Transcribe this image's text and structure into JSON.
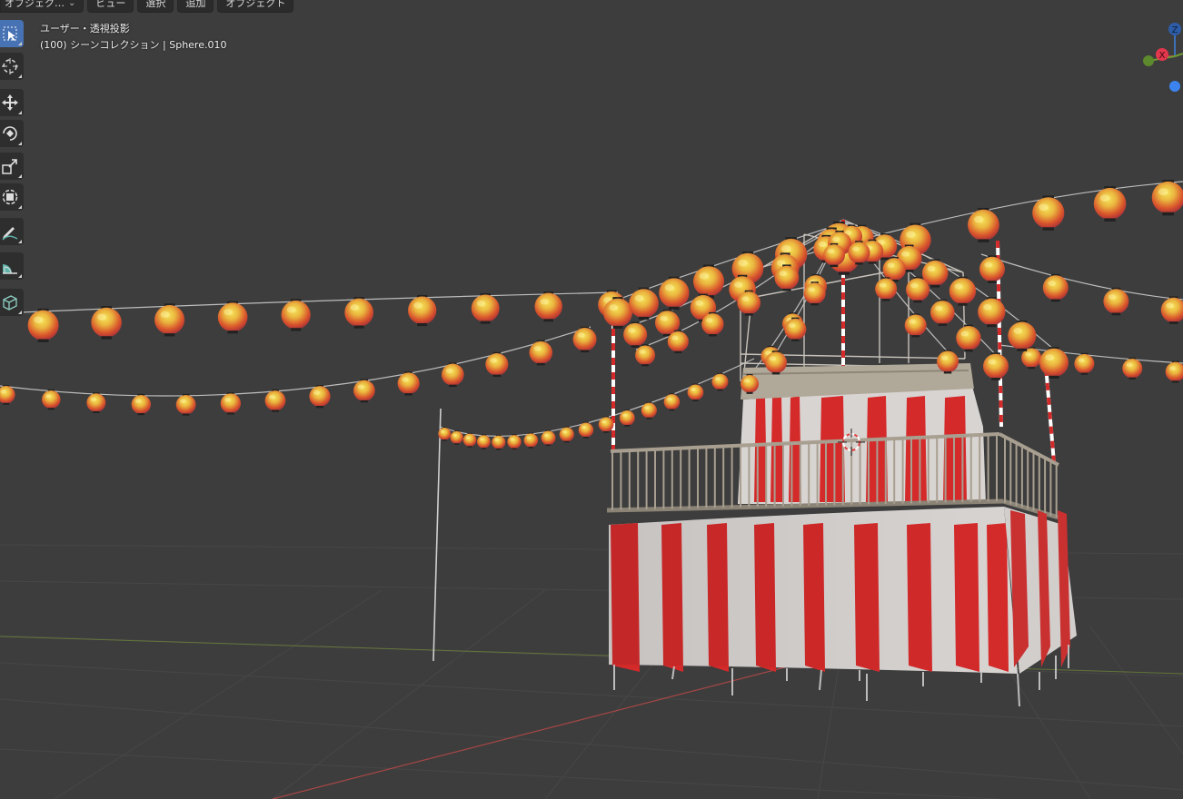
{
  "header": {
    "menu": [
      {
        "label": "オブジェク…",
        "dropdown": true,
        "name": "mode-dropdown"
      },
      {
        "label": "ビュー",
        "name": "menu-view"
      },
      {
        "label": "選択",
        "name": "menu-select"
      },
      {
        "label": "追加",
        "name": "menu-add"
      },
      {
        "label": "オブジェクト",
        "name": "menu-object"
      }
    ]
  },
  "viewport": {
    "view_name": "ユーザー・透視投影",
    "collection_info": "(100) シーンコレクション | Sphere.010"
  },
  "toolbar": [
    {
      "icon": "select-box-icon",
      "active": true
    },
    {
      "icon": "cursor-icon",
      "active": false
    },
    {
      "icon": "move-icon",
      "active": false
    },
    {
      "icon": "rotate-icon",
      "active": false
    },
    {
      "icon": "scale-icon",
      "active": false
    },
    {
      "icon": "transform-icon",
      "active": false
    },
    {
      "icon": "annotate-icon",
      "active": false
    },
    {
      "icon": "measure-icon",
      "active": false
    },
    {
      "icon": "add-cube-icon",
      "active": false
    }
  ],
  "gizmo": {
    "labels": {
      "z": "Z",
      "x": "X"
    }
  },
  "colors": {
    "background": "#3d3d3d",
    "grid": "#474747",
    "x_axis": "#c24848",
    "y_axis": "#7b9838",
    "tool_active": "#4772b3",
    "stripe_red": "#d42a2a",
    "stripe_white": "#d8d4d2",
    "railing": "#a89f90"
  }
}
